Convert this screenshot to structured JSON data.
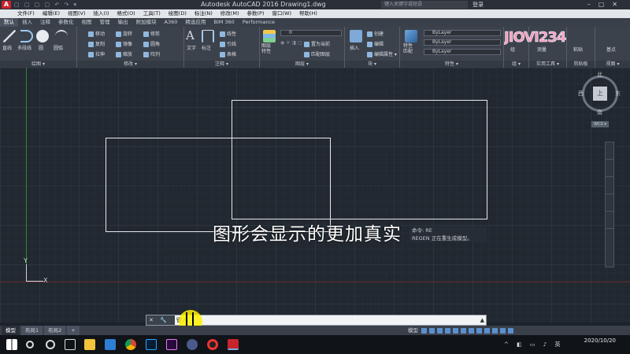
{
  "titlebar": {
    "logo": "A",
    "title": "Autodesk AutoCAD 2016    Drawing1.dwg",
    "search_placeholder": "键入关键字或短语",
    "login": "登录"
  },
  "menu": [
    "文件(F)",
    "编辑(E)",
    "视图(V)",
    "插入(I)",
    "格式(O)",
    "工具(T)",
    "绘图(D)",
    "标注(N)",
    "修改(M)",
    "参数(P)",
    "窗口(W)",
    "帮助(H)"
  ],
  "ribbon_tabs": [
    "默认",
    "插入",
    "注释",
    "参数化",
    "视图",
    "管理",
    "输出",
    "附加模块",
    "A360",
    "精选应用",
    "BIM 360",
    "Performance"
  ],
  "ribbon": {
    "draw": {
      "title": "绘图 ▾",
      "line": "直线",
      "polyline": "多段线",
      "circle": "圆",
      "arc": "圆弧"
    },
    "modify": {
      "title": "修改 ▾",
      "move": "移动",
      "rotate": "旋转",
      "trim": "修剪",
      "copy": "复制",
      "mirror": "镜像",
      "fillet": "圆角",
      "stretch": "拉伸",
      "scale": "缩放",
      "array": "阵列"
    },
    "annotation": {
      "title": "注释 ▾",
      "text": "文字",
      "dimension": "标注",
      "linear": "线性",
      "leader": "引线",
      "table": "表格"
    },
    "layers": {
      "title": "图层 ▾",
      "properties": "图层\n特性",
      "layer_value": "0",
      "set_current": "置为当前",
      "match_layer": "匹配图层"
    },
    "block": {
      "title": "块 ▾",
      "insert": "插入",
      "create": "创建",
      "edit": "编辑",
      "edit_attr": "编辑属性 ▾"
    },
    "properties": {
      "title": "特性 ▾",
      "match": "特性\n匹配",
      "bylayer1": "ByLayer",
      "bylayer2": "ByLayer",
      "bylayer3": "ByLayer"
    },
    "group": {
      "title": "组 ▾",
      "label": "组"
    },
    "utilities": {
      "title": "实用工具 ▾",
      "measure": "测量"
    },
    "clipboard": {
      "title": "剪贴板",
      "paste": "粘贴"
    },
    "view": {
      "title": "视图 ▾",
      "base": "基点"
    }
  },
  "watermark": "JIOVI234",
  "viewcube": {
    "north": "北",
    "south": "南",
    "west": "西",
    "east": "东",
    "face": "上",
    "wcs": "WCS ▾"
  },
  "ucs": {
    "x": "X",
    "y": "Y"
  },
  "subtitle": "图形会显示的更加真实",
  "command_history": [
    "命令: RE",
    "REGEN 正在重生成模型。"
  ],
  "command_line": {
    "buttons": "✕ 🔧",
    "value": "键入",
    "arrow": "▲"
  },
  "layout_tabs": [
    "模型",
    "布局1",
    "布局2",
    "+"
  ],
  "status": {
    "mode": "模型"
  },
  "taskbar": {
    "time": "",
    "date": "2020/10/20",
    "ime": "英"
  },
  "colors": {
    "canvas": "#212830",
    "grid": "#2c343e",
    "highlight": "#fff000",
    "autocad_red": "#c8242b"
  }
}
